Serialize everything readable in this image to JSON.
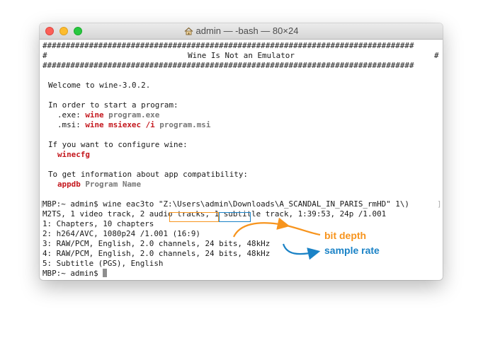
{
  "window": {
    "title": "admin — -bash — 80×24",
    "title_icon": "home-icon"
  },
  "terminal": {
    "hash_line": "################################################################################",
    "banner_left": "#",
    "banner_center": "Wine Is Not an Emulator",
    "banner_right": "#",
    "welcome": "Welcome to wine-3.0.2.",
    "start_header": "In order to start a program:",
    "exe_label": ".exe:",
    "exe_cmd": "wine",
    "exe_arg": "program.exe",
    "msi_label": ".msi:",
    "msi_cmd": "wine msiexec /i",
    "msi_arg": "program.msi",
    "configure_header": "If you want to configure wine:",
    "configure_cmd": "winecfg",
    "compat_header": "To get information about app compatibility:",
    "compat_cmd": "appdb",
    "compat_arg": "Program Name",
    "cmd_bracket_left": "[",
    "cmd_line": "MBP:~ admin$ wine eac3to \"Z:\\Users\\admin\\Downloads\\A_SCANDAL_IN_PARIS_rmHD\" 1\\)",
    "cmd_bracket_right": "]",
    "out_summary": "M2TS, 1 video track, 2 audio tracks, 1 subtitle track, 1:39:53, 24p /1.001",
    "out_1": "1: Chapters, 10 chapters",
    "out_2": "2: h264/AVC, 1080p24 /1.001 (16:9)",
    "out_3": "3: RAW/PCM, English, 2.0 channels, 24 bits, 48kHz",
    "out_4": "4: RAW/PCM, English, 2.0 channels, 24 bits, 48kHz",
    "out_5": "5: Subtitle (PGS), English",
    "prompt": "MBP:~ admin$ "
  },
  "annotations": {
    "bit_depth": "bit depth",
    "sample_rate": "sample rate",
    "bit_depth_color": "#f7941d",
    "sample_rate_color": "#1a82c6"
  }
}
